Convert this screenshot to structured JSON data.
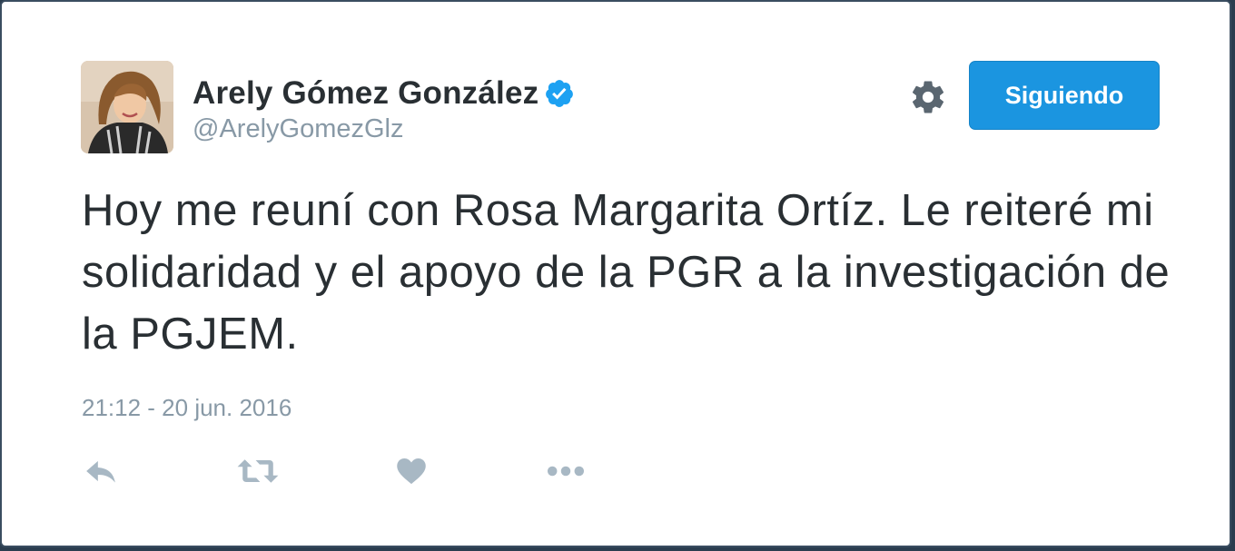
{
  "tweet": {
    "author": {
      "display_name": "Arely Gómez González",
      "handle": "@ArelyGomezGlz",
      "verified": true,
      "avatar": "profile-photo"
    },
    "follow_button_label": "Siguiendo",
    "text": "Hoy me reuní con Rosa Margarita Ortíz. Le reiteré mi solidaridad y el apoyo de la PGR a la investigación de la PGJEM.",
    "timestamp": "21:12 - 20 jun. 2016",
    "actions": [
      "reply-icon",
      "retweet-icon",
      "like-icon",
      "more-icon"
    ]
  },
  "colors": {
    "accent": "#1b95e0",
    "verified_badge": "#1da1f2",
    "text": "#292f33",
    "muted": "#8899a6",
    "icon": "#a8b8c4",
    "gear": "#5a6670"
  }
}
